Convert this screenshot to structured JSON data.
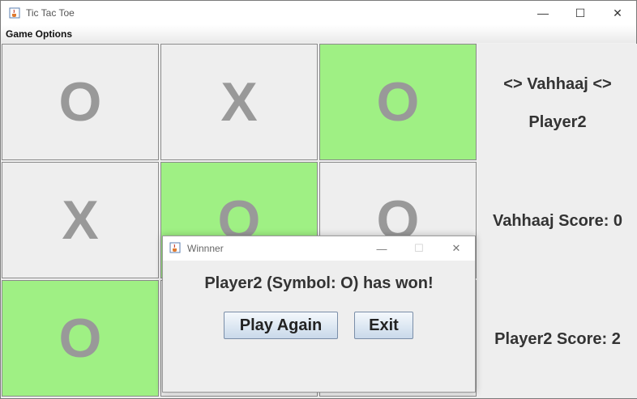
{
  "window": {
    "title": "Tic Tac Toe",
    "icon": "java-cup-icon",
    "controls": {
      "minimize": "—",
      "maximize": "☐",
      "close": "✕"
    }
  },
  "menu": {
    "items": [
      "Game Options"
    ]
  },
  "board": {
    "cells": [
      "O",
      "X",
      "O",
      "X",
      "O",
      "O",
      "O",
      "",
      ""
    ],
    "highlight_color": "#9ff084",
    "cell_color": "#eeeeee",
    "symbol_color": "#999999"
  },
  "side": {
    "current_name": "<> Vahhaaj <>",
    "current_player": "Player2",
    "score1": "Vahhaaj Score: 0",
    "score2": "Player2 Score: 2"
  },
  "dialog": {
    "title": "Winnner",
    "message": "Player2 (Symbol: O) has won!",
    "play_again": "Play Again",
    "exit": "Exit",
    "controls": {
      "minimize": "—",
      "maximize": "☐",
      "close": "✕"
    }
  }
}
